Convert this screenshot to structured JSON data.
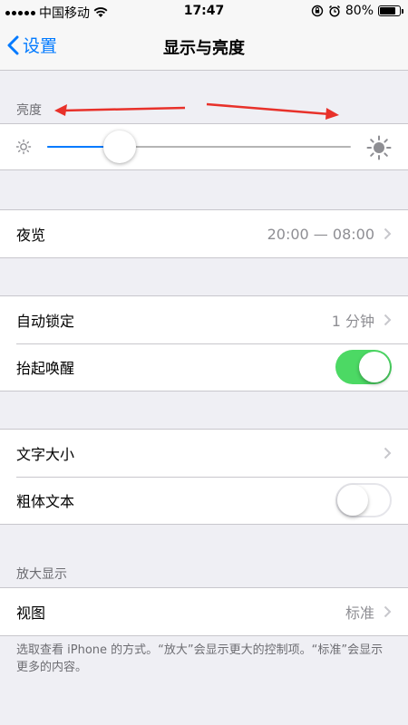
{
  "status_bar": {
    "carrier": "中国移动",
    "time": "17:47",
    "battery_percent": "80%",
    "battery_level": 0.8
  },
  "nav": {
    "back_label": "设置",
    "title": "显示与亮度"
  },
  "brightness": {
    "header": "亮度",
    "level": 0.24
  },
  "night_shift": {
    "label": "夜览",
    "value": "20:00 — 08:00"
  },
  "auto_lock": {
    "label": "自动锁定",
    "value": "1 分钟"
  },
  "raise_to_wake": {
    "label": "抬起唤醒",
    "enabled": true
  },
  "text_size": {
    "label": "文字大小"
  },
  "bold_text": {
    "label": "粗体文本",
    "enabled": false
  },
  "zoom": {
    "header": "放大显示",
    "view_label": "视图",
    "view_value": "标准",
    "footer": "选取查看 iPhone 的方式。“放大”会显示更大的控制项。“标准”会显示更多的内容。"
  },
  "colors": {
    "accent": "#007aff",
    "switch_on": "#4cd964",
    "annotation_arrow": "#e8312a"
  }
}
